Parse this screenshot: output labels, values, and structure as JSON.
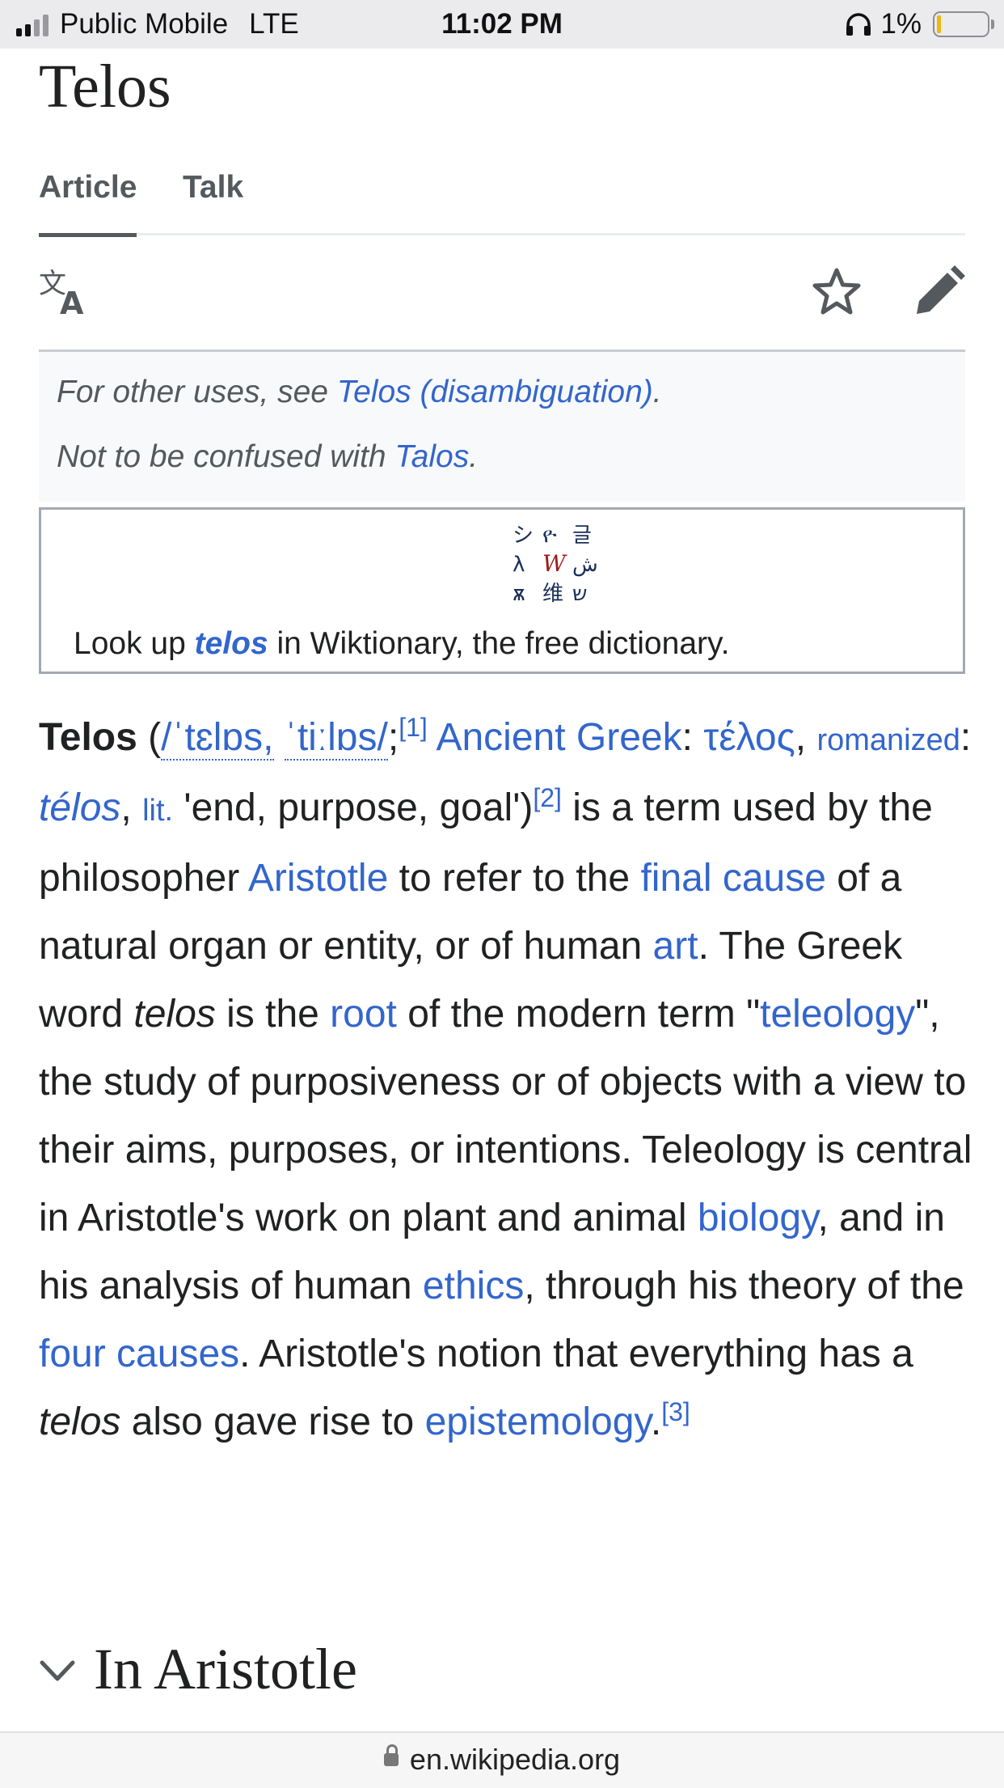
{
  "status_bar": {
    "carrier": "Public Mobile",
    "network": "LTE",
    "time": "11:02 PM",
    "battery": "1%"
  },
  "page": {
    "title": "Telos",
    "tabs": [
      "Article",
      "Talk"
    ],
    "icons": [
      "language-icon",
      "star-icon",
      "edit-pencil-icon"
    ]
  },
  "hatnotes": [
    {
      "prefix": "For other uses, see ",
      "link": "Telos (disambiguation)",
      "suffix": "."
    },
    {
      "prefix": "Not to be confused with ",
      "link": "Talos",
      "suffix": "."
    }
  ],
  "wiktionary": {
    "before": "Look up ",
    "term": "telos",
    "after": " in Wiktionary, the free dictionary."
  },
  "paragraph": {
    "lead_bold": "Telos",
    "ipa1": "/ˈtɛlɒs,",
    "ipa2": "ˈtiːlɒs/",
    "ref1": "[1]",
    "lang_link": "Ancient Greek",
    "greek": "τέλος",
    "romanized_label": "romanized",
    "romanized_word": "télos",
    "lit_label": "lit.",
    "gloss": "'end, purpose, goal')",
    "ref2": "[2]",
    "t1": " is a term used by the philosopher ",
    "link_aristotle": "Aristotle",
    "t2": " to refer to the ",
    "link_final_cause": "final cause",
    "t3": " of a natural organ or entity, or of human ",
    "link_art": "art",
    "t4": ". The Greek word ",
    "telos_italic": "telos",
    "t5": " is the ",
    "link_root": "root",
    "t6": " of the modern term \"",
    "link_teleology": "teleology",
    "t7": "\", the study of purposiveness or of objects with a view to their aims, purposes, or intentions. Teleology is central in Aristotle's work on plant and animal ",
    "link_biology": "biology",
    "t8": ", and in his analysis of human ",
    "link_ethics": "ethics",
    "t9": ", through his theory of the ",
    "link_four_causes": "four causes",
    "t10": ". Aristotle's notion that everything has a ",
    "telos_italic2": "telos",
    "t11": " also gave rise to ",
    "link_epistemology": "epistemology",
    "t12": ".",
    "ref3": "[3]"
  },
  "section": {
    "heading": "In Aristotle"
  },
  "url_bar": {
    "url": "en.wikipedia.org"
  }
}
